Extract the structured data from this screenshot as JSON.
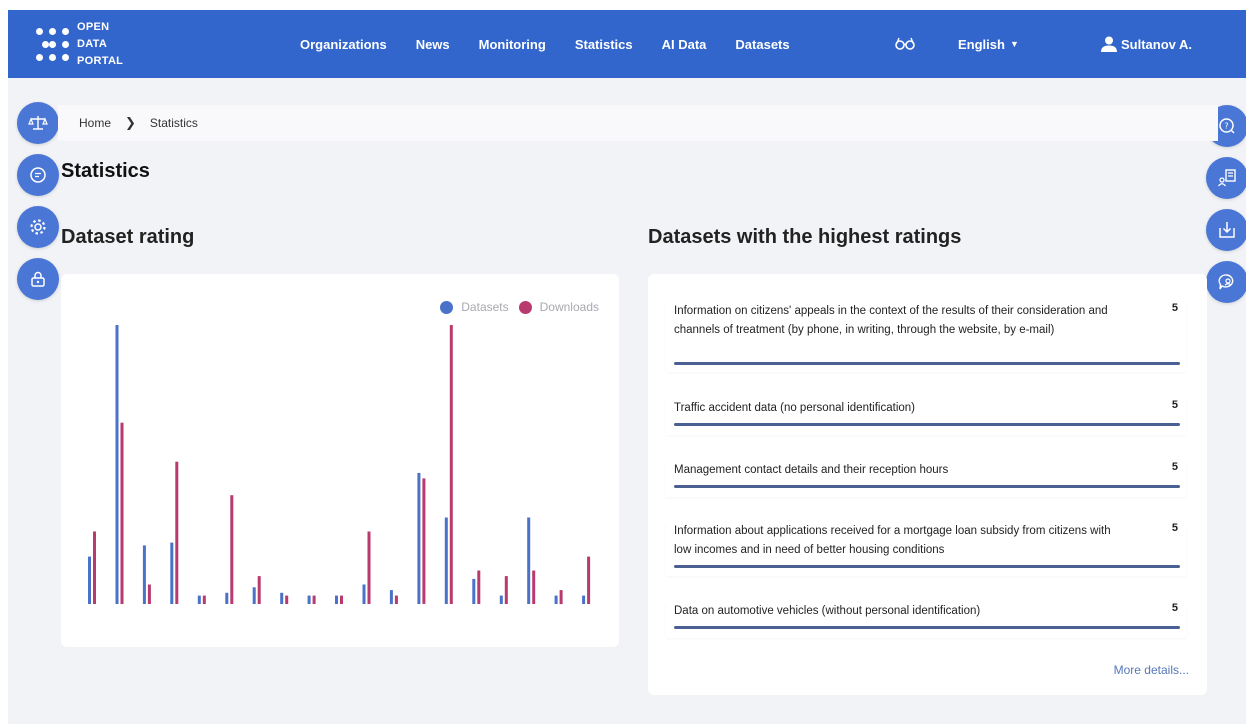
{
  "logo": {
    "line1": "OPEN",
    "line2": "DATA",
    "line3": "PORTAL"
  },
  "nav": [
    {
      "label": "Organizations"
    },
    {
      "label": "News"
    },
    {
      "label": "Monitoring"
    },
    {
      "label": "Statistics"
    },
    {
      "label": "AI Data"
    },
    {
      "label": "Datasets"
    }
  ],
  "header": {
    "language": "English",
    "user": "Sultanov A.",
    "accessibility_icon": "glasses-icon"
  },
  "left_side_buttons": [
    "scales-icon",
    "chat-icon",
    "gear-icon",
    "lock-icon"
  ],
  "right_side_buttons": [
    "help-chat-icon",
    "document-user-icon",
    "download-icon",
    "support-chat-icon"
  ],
  "breadcrumb": {
    "home": "Home",
    "separator": "❯",
    "current": "Statistics"
  },
  "page_title": "Statistics",
  "rating_section": {
    "title": "Dataset rating"
  },
  "top_section": {
    "title": "Datasets with the highest ratings",
    "items": [
      {
        "text": "Information on citizens' appeals in the context of the results of their consideration and channels of treatment (by phone, in writing, through the website, by e-mail)",
        "score": "5"
      },
      {
        "text": "Traffic accident data (no personal identification)",
        "score": "5"
      },
      {
        "text": "Management contact details and their reception hours",
        "score": "5"
      },
      {
        "text": "Information about applications received for a mortgage loan subsidy from citizens with low incomes and in need of better housing conditions",
        "score": "5"
      },
      {
        "text": "Data on automotive vehicles (without personal identification)",
        "score": "5"
      }
    ],
    "more": "More details..."
  },
  "colors": {
    "header": "#3366cc",
    "datasets": "#4a72c8",
    "downloads": "#b83a6e",
    "rating_bar": "#4a5f92"
  },
  "chart_data": {
    "type": "bar",
    "categories": [
      "",
      "",
      "",
      "",
      "",
      "",
      "",
      "",
      "",
      "",
      "",
      "",
      "",
      "",
      "",
      "",
      "",
      "",
      "",
      ""
    ],
    "series": [
      {
        "name": "Datasets",
        "values": [
          17,
          100,
          21,
          22,
          3,
          4,
          6,
          4,
          3,
          3,
          7,
          5,
          47,
          31,
          9,
          3,
          31,
          3,
          3,
          0
        ]
      },
      {
        "name": "Downloads",
        "values": [
          26,
          65,
          7,
          51,
          3,
          39,
          10,
          3,
          3,
          3,
          26,
          3,
          45,
          100,
          12,
          10,
          12,
          5,
          17,
          0
        ]
      }
    ],
    "ylim": [
      0,
      100
    ],
    "grid": false,
    "legend_position": "top-right"
  }
}
